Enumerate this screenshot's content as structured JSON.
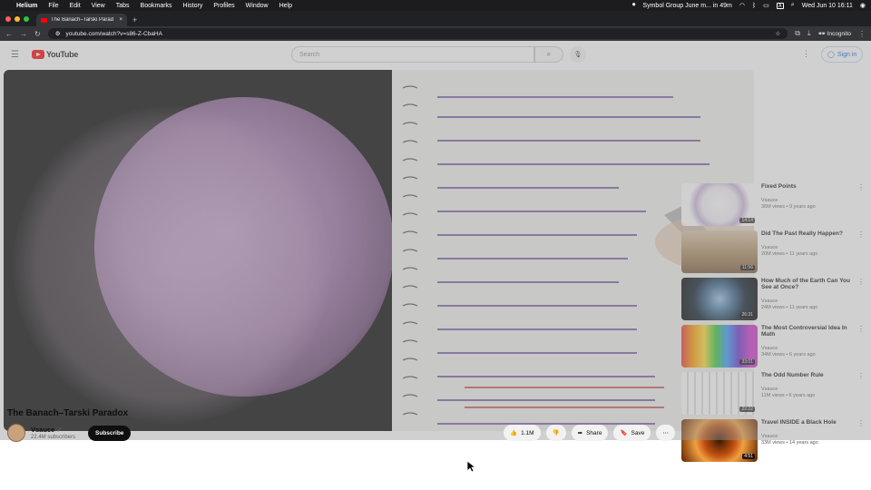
{
  "menubar": {
    "app": "Helium",
    "items": [
      "File",
      "Edit",
      "View",
      "Tabs",
      "Bookmarks",
      "History",
      "Profiles",
      "Window",
      "Help"
    ],
    "event": "Symbol Group June m... in 49m",
    "datetime": "Wed Jun 10  16:11"
  },
  "browser": {
    "tab_title": "The Banach–Tarski Parad",
    "url": "youtube.com/watch?v=s86-Z-CbaHA",
    "incognito": "Incognito"
  },
  "youtube": {
    "logo": "YouTube",
    "search_placeholder": "Search",
    "signin": "Sign in"
  },
  "video": {
    "title": "The Banach–Tarski Paradox",
    "channel": "Vsauce",
    "subscribers": "22.4M subscribers",
    "subscribe": "Subscribe",
    "likes": "1.1M",
    "share": "Share",
    "save": "Save"
  },
  "recommendations": [
    {
      "title": "Fixed Points",
      "meta1": "Vsauce",
      "meta2": "36M views • 9 years ago",
      "duration": "14:14"
    },
    {
      "title": "Did The Past Really Happen?",
      "meta1": "Vsauce",
      "meta2": "20M views • 11 years ago",
      "duration": "11:56"
    },
    {
      "title": "How Much of the Earth Can You See at Once?",
      "meta1": "Vsauce",
      "meta2": "24M views • 11 years ago",
      "duration": "26:31"
    },
    {
      "title": "The Most Controversial Idea In Math",
      "meta1": "Vsauce",
      "meta2": "34M views • 6 years ago",
      "duration": "33:01"
    },
    {
      "title": "The Odd Number Rule",
      "meta1": "Vsauce",
      "meta2": "11M views • 6 years ago",
      "duration": "22:22"
    },
    {
      "title": "Travel INSIDE a Black Hole",
      "meta1": "Vsauce",
      "meta2": "33M views • 14 years ago",
      "duration": "4:51"
    }
  ],
  "colors": {
    "youtube_red": "#ff0000",
    "link_blue": "#065fd4",
    "chrome_dark": "#202124"
  }
}
